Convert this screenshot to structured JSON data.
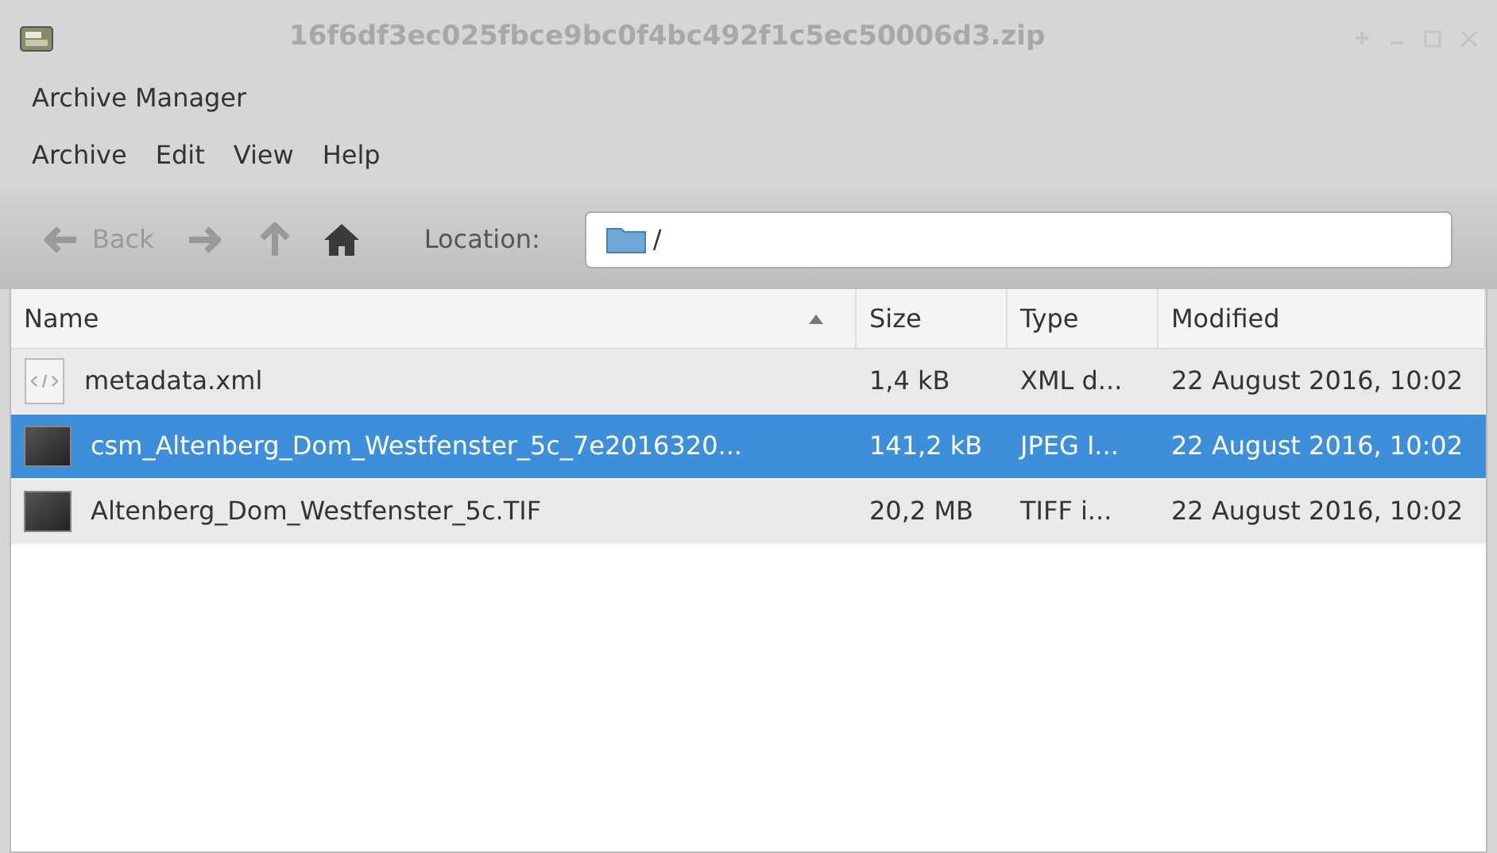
{
  "window": {
    "title": "16f6df3ec025fbce9bc0f4bc492f1c5ec50006d3.zip"
  },
  "app_name": "Archive Manager",
  "menu": [
    "Archive",
    "Edit",
    "View",
    "Help"
  ],
  "toolbar": {
    "back": "Back",
    "location_label": "Location:",
    "location": "/"
  },
  "table": {
    "columns": [
      {
        "label": "Name",
        "sorted": true
      },
      {
        "label": "Size",
        "sorted": false
      },
      {
        "label": "Type",
        "sorted": false
      },
      {
        "label": "Modified",
        "sorted": false
      }
    ],
    "rows": [
      {
        "kind": "xml",
        "name": "metadata.xml",
        "size": "1,4 kB",
        "type": "XML d...",
        "modified": "22 August 2016, 10:02",
        "selected": false
      },
      {
        "kind": "image",
        "name": "csm_Altenberg_Dom_Westfenster_5c_7e2016320...",
        "size": "141,2 kB",
        "type": "JPEG I...",
        "modified": "22 August 2016, 10:02",
        "selected": true
      },
      {
        "kind": "image",
        "name": "Altenberg_Dom_Westfenster_5c.TIF",
        "size": "20,2 MB",
        "type": "TIFF i...",
        "modified": "22 August 2016, 10:02",
        "selected": false
      }
    ]
  }
}
